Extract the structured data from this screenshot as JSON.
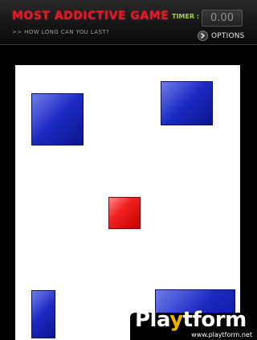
{
  "header": {
    "title": "MOST ADDICTIVE GAME",
    "subtitle": ">> HOW LONG CAN YOU LAST?",
    "timer_label": "TIMER :",
    "timer_value": "0.00",
    "options_label": "OPTIONS",
    "options_icon": "chevron-right-icon"
  },
  "colors": {
    "title": "#e3192b",
    "timer_label": "#a6d23a",
    "blue_block": "#1d2bc4",
    "red_block": "#f02020",
    "field": "#ffffff",
    "border": "#000000"
  },
  "watermark": {
    "logo_prefix": "Pla",
    "logo_y": "y",
    "logo_suffix": "tform",
    "url": "www.playtform.net"
  }
}
